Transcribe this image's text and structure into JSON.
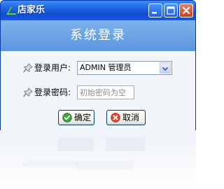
{
  "window": {
    "title": "店家乐",
    "controls": {
      "minimize": "minimize-button",
      "maximize": "maximize-button",
      "close": "close-button"
    }
  },
  "header": {
    "title": "系统登录"
  },
  "form": {
    "user_label": "登录用户:",
    "user_value": "ADMIN 管理员",
    "password_label": "登录密码:",
    "password_placeholder": "初始密码为空"
  },
  "buttons": {
    "ok_label": "确定",
    "cancel_label": "取消"
  },
  "icons": {
    "app": "app-logo-icon",
    "user_row": "pin-icon",
    "password_row": "pin-icon",
    "ok": "check-icon",
    "cancel": "cancel-icon",
    "dropdown": "chevron-down-icon"
  },
  "colors": {
    "titlebar": "#1a5fe0",
    "header_band": "#6aa3e6",
    "close_button": "#d4542e",
    "ok_icon": "#2f9e2f",
    "cancel_icon": "#d9412b"
  }
}
